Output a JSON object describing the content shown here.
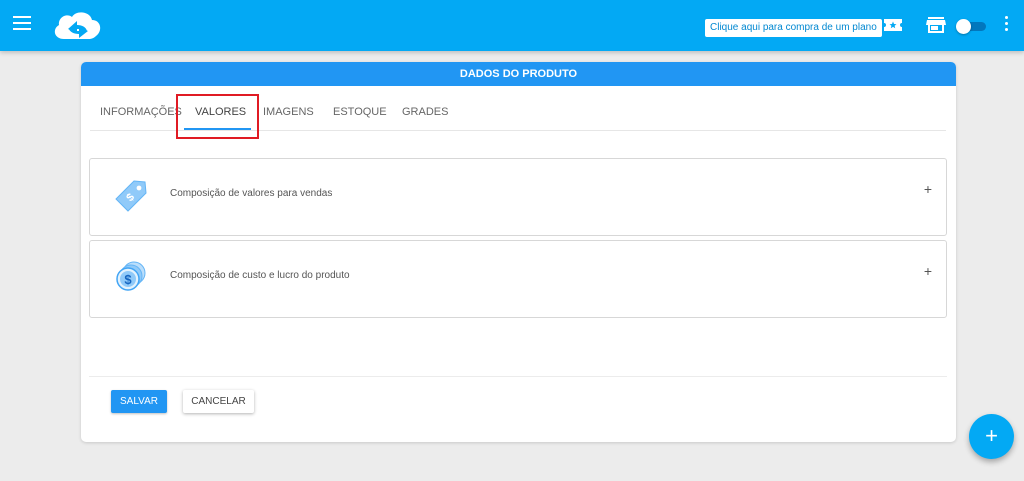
{
  "topbar": {
    "plan_button_label": "Clique aqui para compra de um plano"
  },
  "icons": {
    "menu": "menu-icon",
    "logo": "cloud-logo-icon",
    "ticket": "ticket-icon",
    "store": "store-icon",
    "more": "more-vertical-icon",
    "price_tag": "price-tag-icon",
    "coins": "coins-icon"
  },
  "colors": {
    "topbar": "#03a9f4",
    "card_header": "#2196f3",
    "highlight": "#e01b24"
  },
  "card": {
    "title": "DADOS DO PRODUTO",
    "tabs": [
      {
        "label": "INFORMAÇÕES",
        "active": false
      },
      {
        "label": "VALORES",
        "active": true
      },
      {
        "label": "IMAGENS",
        "active": false
      },
      {
        "label": "ESTOQUE",
        "active": false
      },
      {
        "label": "GRADES",
        "active": false
      }
    ],
    "panels": [
      {
        "title": "Composição de valores para vendas",
        "expand": "+"
      },
      {
        "title": "Composição de custo e lucro do produto",
        "expand": "+"
      }
    ],
    "actions": {
      "save_label": "SALVAR",
      "cancel_label": "CANCELAR"
    }
  },
  "fab": {
    "label": "+"
  }
}
